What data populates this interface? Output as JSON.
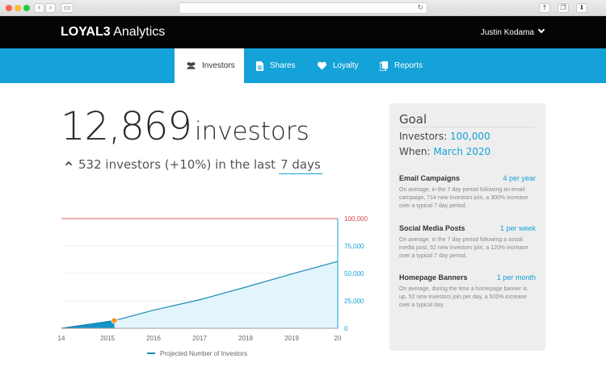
{
  "browser": {
    "back_icon": "chevron-left-icon",
    "forward_icon": "chevron-right-icon",
    "sidebar_icon": "sidebar-icon",
    "reload_icon": "reload-icon",
    "share_icon": "share-icon",
    "tabs_icon": "tabs-icon",
    "download_icon": "download-icon"
  },
  "app": {
    "brand_bold": "LOYAL3",
    "brand_rest": " Analytics",
    "user_name": "Justin Kodama"
  },
  "tabs": [
    {
      "label": "Investors",
      "icon": "users-icon",
      "active": true
    },
    {
      "label": "Shares",
      "icon": "document-icon",
      "active": false
    },
    {
      "label": "Loyalty",
      "icon": "heart-icon",
      "active": false
    },
    {
      "label": "Reports",
      "icon": "reports-icon",
      "active": false
    }
  ],
  "summary": {
    "count": "12,869",
    "unit": "investors",
    "delta_text": "532 investors (+10%) in the last",
    "period": "7 days"
  },
  "goal": {
    "title": "Goal",
    "investors_label": "Investors:",
    "investors_value": "100,000",
    "when_label": "When:",
    "when_value": "March 2020",
    "items": [
      {
        "title": "Email Campaigns",
        "frequency": "4 per year",
        "desc": "On average, in the 7 day period following an email campaign, 714 new investors join, a 300% increase over a typical 7 day period."
      },
      {
        "title": "Social Media Posts",
        "frequency": "1 per week",
        "desc": "On average, in the 7 day period following a social media post, 52 new investors join, a 120% increase over a typical 7 day period."
      },
      {
        "title": "Homepage Banners",
        "frequency": "1 per month",
        "desc": "On average, during the time a homepage banner is up, 52 new investors join per day, a 520% increase over a typical day."
      }
    ]
  },
  "colors": {
    "accent": "#14a2d8",
    "goal_line": "#e8585c",
    "marker": "#f7941d",
    "header": "#040404"
  },
  "chart_data": {
    "type": "area",
    "x_tick_labels": [
      "14",
      "2015",
      "2016",
      "2017",
      "2018",
      "2019",
      "20"
    ],
    "x_ticks": [
      2014,
      2015,
      2016,
      2017,
      2018,
      2019,
      2020
    ],
    "y_tick_labels": [
      "0",
      "25,000",
      "50,000",
      "75,000",
      "100,000"
    ],
    "y_ticks": [
      0,
      25000,
      50000,
      75000,
      100000
    ],
    "ylim": [
      0,
      100000
    ],
    "xlim": [
      2014,
      2020
    ],
    "goal_value": 100000,
    "actual": {
      "x": [
        2014.0,
        2015.15
      ],
      "y": [
        0,
        7000
      ]
    },
    "projected": {
      "x": [
        2015.15,
        2016.0,
        2017.0,
        2018.0,
        2019.0,
        2020.0
      ],
      "y": [
        7000,
        16500,
        26000,
        37500,
        49500,
        61000
      ]
    },
    "current_marker": {
      "x": 2015.15,
      "y": 7000
    },
    "legend": "Projected Number of Investors",
    "grid": true
  }
}
